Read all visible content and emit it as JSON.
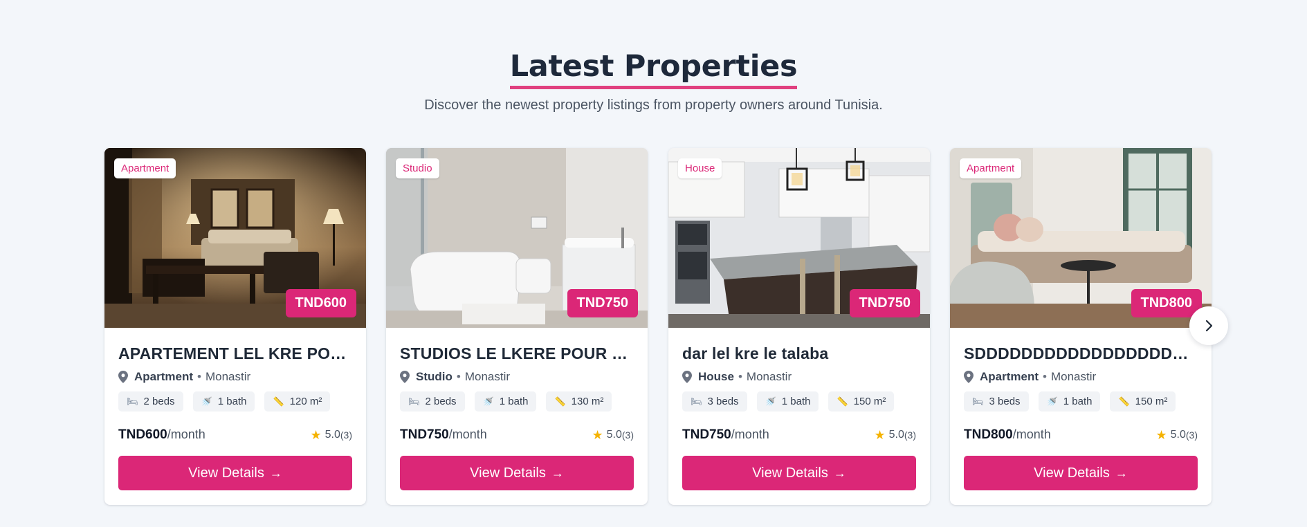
{
  "section": {
    "title": "Latest Properties",
    "subtitle": "Discover the newest property listings from property owners around Tunisia."
  },
  "properties": [
    {
      "type_badge": "Apartment",
      "price_badge": "TND600",
      "title": "APARTEMENT LEL KRE POUR ETUDIANTS",
      "type": "Apartment",
      "city": "Monastir",
      "beds": "2 beds",
      "baths": "1 bath",
      "area": "120 m²",
      "price": "TND600",
      "period": "/month",
      "rating": "5.0",
      "reviews": "(3)",
      "cta": "View Details"
    },
    {
      "type_badge": "Studio",
      "price_badge": "TND750",
      "title": "STUDIOS LE LKERE POUR ETUDIANTS",
      "type": "Studio",
      "city": "Monastir",
      "beds": "2 beds",
      "baths": "1 bath",
      "area": "130 m²",
      "price": "TND750",
      "period": "/month",
      "rating": "5.0",
      "reviews": "(3)",
      "cta": "View Details"
    },
    {
      "type_badge": "House",
      "price_badge": "TND750",
      "title": "dar lel kre le talaba",
      "type": "House",
      "city": "Monastir",
      "beds": "3 beds",
      "baths": "1 bath",
      "area": "150 m²",
      "price": "TND750",
      "period": "/month",
      "rating": "5.0",
      "reviews": "(3)",
      "cta": "View Details"
    },
    {
      "type_badge": "Apartment",
      "price_badge": "TND800",
      "title": "SDDDDDDDDDDDDDDDDDDDDDDDD",
      "type": "Apartment",
      "city": "Monastir",
      "beds": "3 beds",
      "baths": "1 bath",
      "area": "150 m²",
      "price": "TND800",
      "period": "/month",
      "rating": "5.0",
      "reviews": "(3)",
      "cta": "View Details"
    }
  ],
  "icons": {
    "location": "map-pin-icon",
    "beds": "bed-icon",
    "baths": "shower-icon",
    "area": "ruler-icon",
    "rating": "star-icon",
    "cta": "arrow-right-icon",
    "carousel_next": "chevron-right-icon"
  },
  "colors": {
    "accent": "#db2777",
    "underline": "#e0407f",
    "star": "#f5b301",
    "background": "#f3f6fa"
  }
}
